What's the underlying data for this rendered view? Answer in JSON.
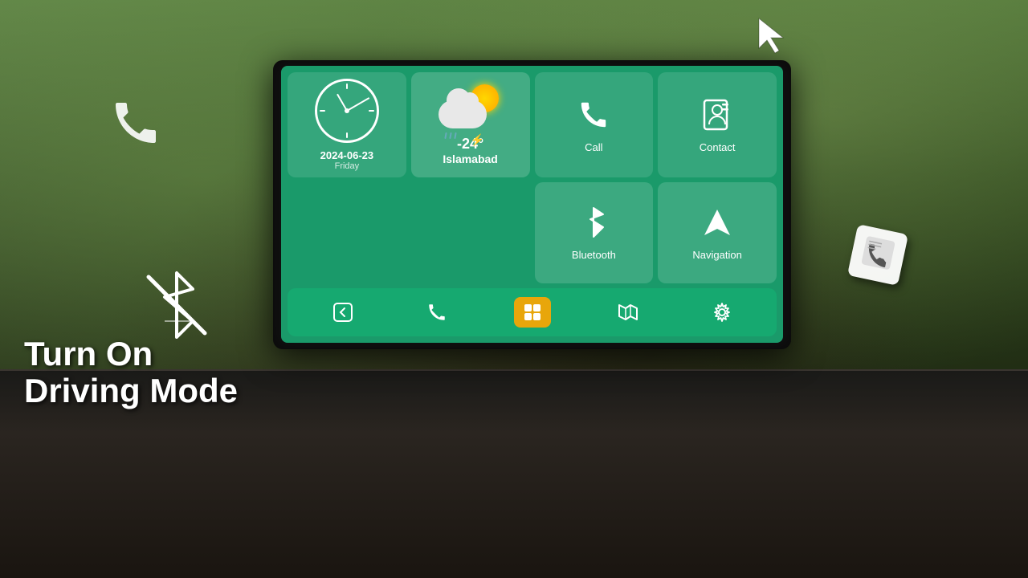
{
  "background": {
    "color": "#3a6a2a"
  },
  "screen": {
    "accent_color": "#1a9a6a",
    "date": "2024-06-23",
    "day": "Friday",
    "weather": {
      "temp": "-24°",
      "city": "Islamabad",
      "condition": "Rain with thunder"
    },
    "tiles": [
      {
        "id": "call",
        "label": "Call",
        "icon": "phone"
      },
      {
        "id": "contact",
        "label": "Contact",
        "icon": "contact-book"
      },
      {
        "id": "bluetooth",
        "label": "Bluetooth",
        "icon": "bluetooth"
      },
      {
        "id": "navigation",
        "label": "Navigation",
        "icon": "navigation"
      }
    ],
    "navbar": [
      {
        "id": "back",
        "icon": "←"
      },
      {
        "id": "phone",
        "icon": "📞"
      },
      {
        "id": "home",
        "icon": "⊞"
      },
      {
        "id": "map",
        "icon": "🗺"
      },
      {
        "id": "settings",
        "icon": "⚙"
      }
    ]
  },
  "overlay_text": {
    "line1": "Turn On",
    "line2": "Driving Mode"
  }
}
